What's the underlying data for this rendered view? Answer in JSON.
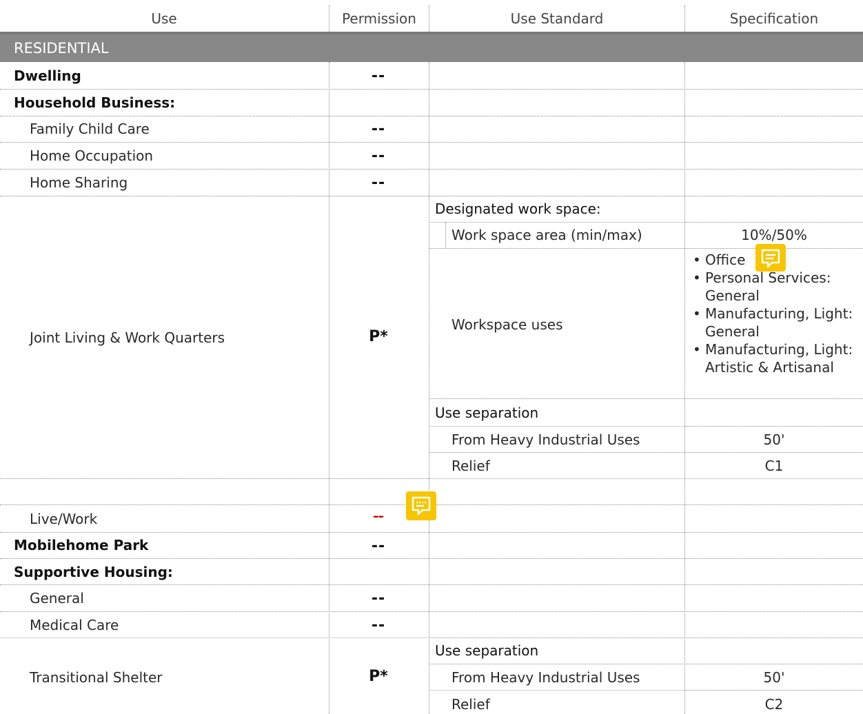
{
  "headers": {
    "use": "Use",
    "permission": "Permission",
    "use_standard": "Use Standard",
    "specification": "Specification"
  },
  "section": "RESIDENTIAL",
  "rows": {
    "dwelling": {
      "use": "Dwelling",
      "permission": "--"
    },
    "household_business": {
      "use": "Household Business:"
    },
    "family_child_care": {
      "use": "Family Child Care",
      "permission": "--"
    },
    "home_occupation": {
      "use": "Home Occupation",
      "permission": "--"
    },
    "home_sharing": {
      "use": "Home Sharing",
      "permission": "--"
    },
    "joint_living": {
      "use": "Joint Living & Work Quarters",
      "permission": "P*",
      "standards": {
        "designated_work_space": "Designated work space:",
        "work_space_area": "Work space area (min/max)",
        "work_space_area_spec": "10%/50%",
        "workspace_uses": "Workspace uses",
        "workspace_uses_list": [
          "Office",
          "Personal Services: General",
          "Manufacturing, Light: General",
          "Manufacturing, Light: Artistic & Artisanal"
        ],
        "use_separation": "Use separation",
        "from_heavy": "From Heavy Industrial Uses",
        "from_heavy_spec": "50'",
        "relief": "Relief",
        "relief_spec": "C1"
      }
    },
    "live_work": {
      "use": "Live/Work",
      "permission": "--"
    },
    "mobilehome_park": {
      "use": "Mobilehome Park",
      "permission": "--"
    },
    "supportive_housing": {
      "use": "Supportive Housing:"
    },
    "general": {
      "use": "General",
      "permission": "--"
    },
    "medical_care": {
      "use": "Medical Care",
      "permission": "--"
    },
    "transitional_shelter": {
      "use": "Transitional Shelter",
      "permission": "P*",
      "standards": {
        "use_separation": "Use separation",
        "from_heavy": "From Heavy Industrial Uses",
        "from_heavy_spec": "50'",
        "relief": "Relief",
        "relief_spec": "C2"
      }
    }
  },
  "icons": {
    "comment": "comment-note-icon"
  },
  "colors": {
    "section_bar": "#888888",
    "comment_note": "#f7c600",
    "strikethrough": "#d10000"
  }
}
